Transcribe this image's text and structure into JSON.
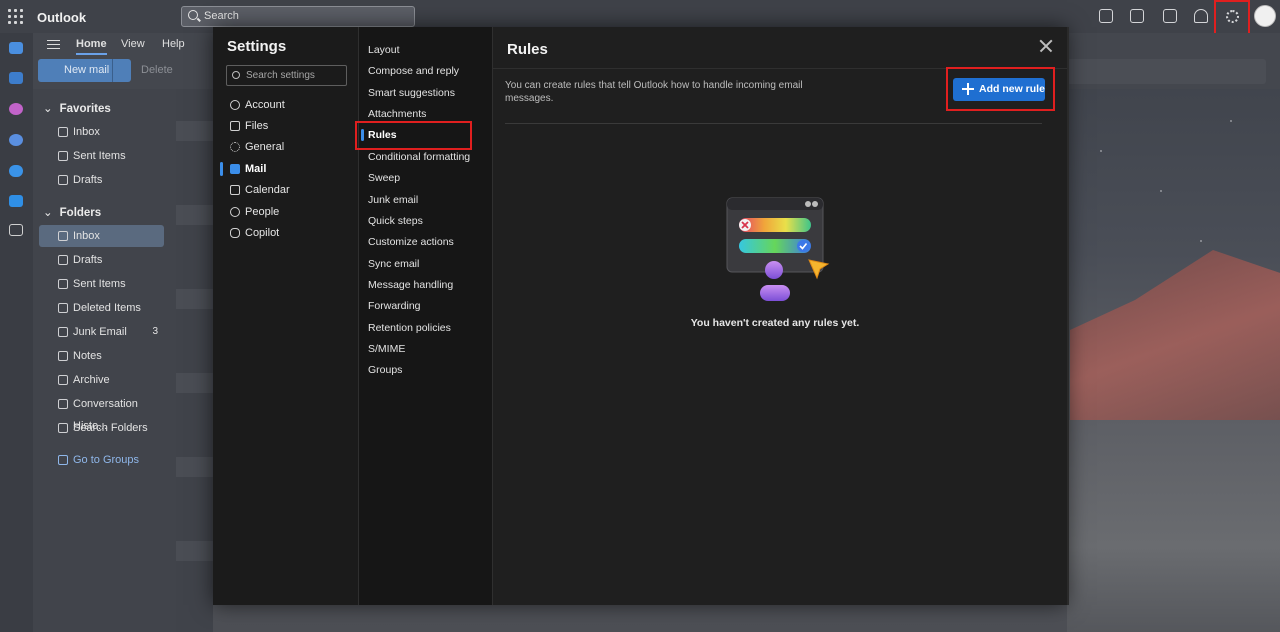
{
  "app": {
    "name": "Outlook",
    "search_placeholder": "Search"
  },
  "ribbon": {
    "tabs": [
      {
        "label": "Home",
        "active": true
      },
      {
        "label": "View",
        "active": false
      },
      {
        "label": "Help",
        "active": false
      }
    ],
    "new_mail_label": "New mail",
    "delete_label": "Delete"
  },
  "folders": {
    "favorites_header": "Favorites",
    "favorites": [
      {
        "label": "Inbox",
        "icon": "inbox-icon"
      },
      {
        "label": "Sent Items",
        "icon": "send-icon"
      },
      {
        "label": "Drafts",
        "icon": "pencil-icon"
      }
    ],
    "folders_header": "Folders",
    "items": [
      {
        "label": "Inbox",
        "icon": "inbox-icon",
        "selected": true,
        "count": ""
      },
      {
        "label": "Drafts",
        "icon": "pencil-icon",
        "count": ""
      },
      {
        "label": "Sent Items",
        "icon": "send-icon",
        "count": ""
      },
      {
        "label": "Deleted Items",
        "icon": "trash-icon",
        "count": ""
      },
      {
        "label": "Junk Email",
        "icon": "junk-icon",
        "count": "3"
      },
      {
        "label": "Notes",
        "icon": "note-icon",
        "count": ""
      },
      {
        "label": "Archive",
        "icon": "archive-icon",
        "count": ""
      },
      {
        "label": "Conversation Histo...",
        "icon": "folder-icon",
        "count": ""
      },
      {
        "label": "Search Folders",
        "icon": "search-folder-icon",
        "count": ""
      }
    ],
    "groups_link": "Go to Groups"
  },
  "settings": {
    "title": "Settings",
    "search_placeholder": "Search settings",
    "categories": [
      {
        "label": "Account",
        "icon": "person-icon"
      },
      {
        "label": "Files",
        "icon": "file-icon"
      },
      {
        "label": "General",
        "icon": "gear-icon"
      },
      {
        "label": "Mail",
        "icon": "mail-icon",
        "active": true
      },
      {
        "label": "Calendar",
        "icon": "calendar-icon"
      },
      {
        "label": "People",
        "icon": "people-icon"
      },
      {
        "label": "Copilot",
        "icon": "copilot-icon"
      }
    ],
    "mail_subsections": [
      "Layout",
      "Compose and reply",
      "Smart suggestions",
      "Attachments",
      "Rules",
      "Conditional formatting",
      "Sweep",
      "Junk email",
      "Quick steps",
      "Customize actions",
      "Sync email",
      "Message handling",
      "Forwarding",
      "Retention policies",
      "S/MIME",
      "Groups"
    ],
    "active_subsection": "Rules"
  },
  "rules": {
    "title": "Rules",
    "description": "You can create rules that tell Outlook how to handle incoming email messages.",
    "add_button_label": "Add new rule",
    "empty_state": "You haven't created any rules yet."
  },
  "colors": {
    "accent": "#1f6fd1",
    "highlight": "#e01f1f",
    "modal_bg": "#1f1f1f"
  }
}
